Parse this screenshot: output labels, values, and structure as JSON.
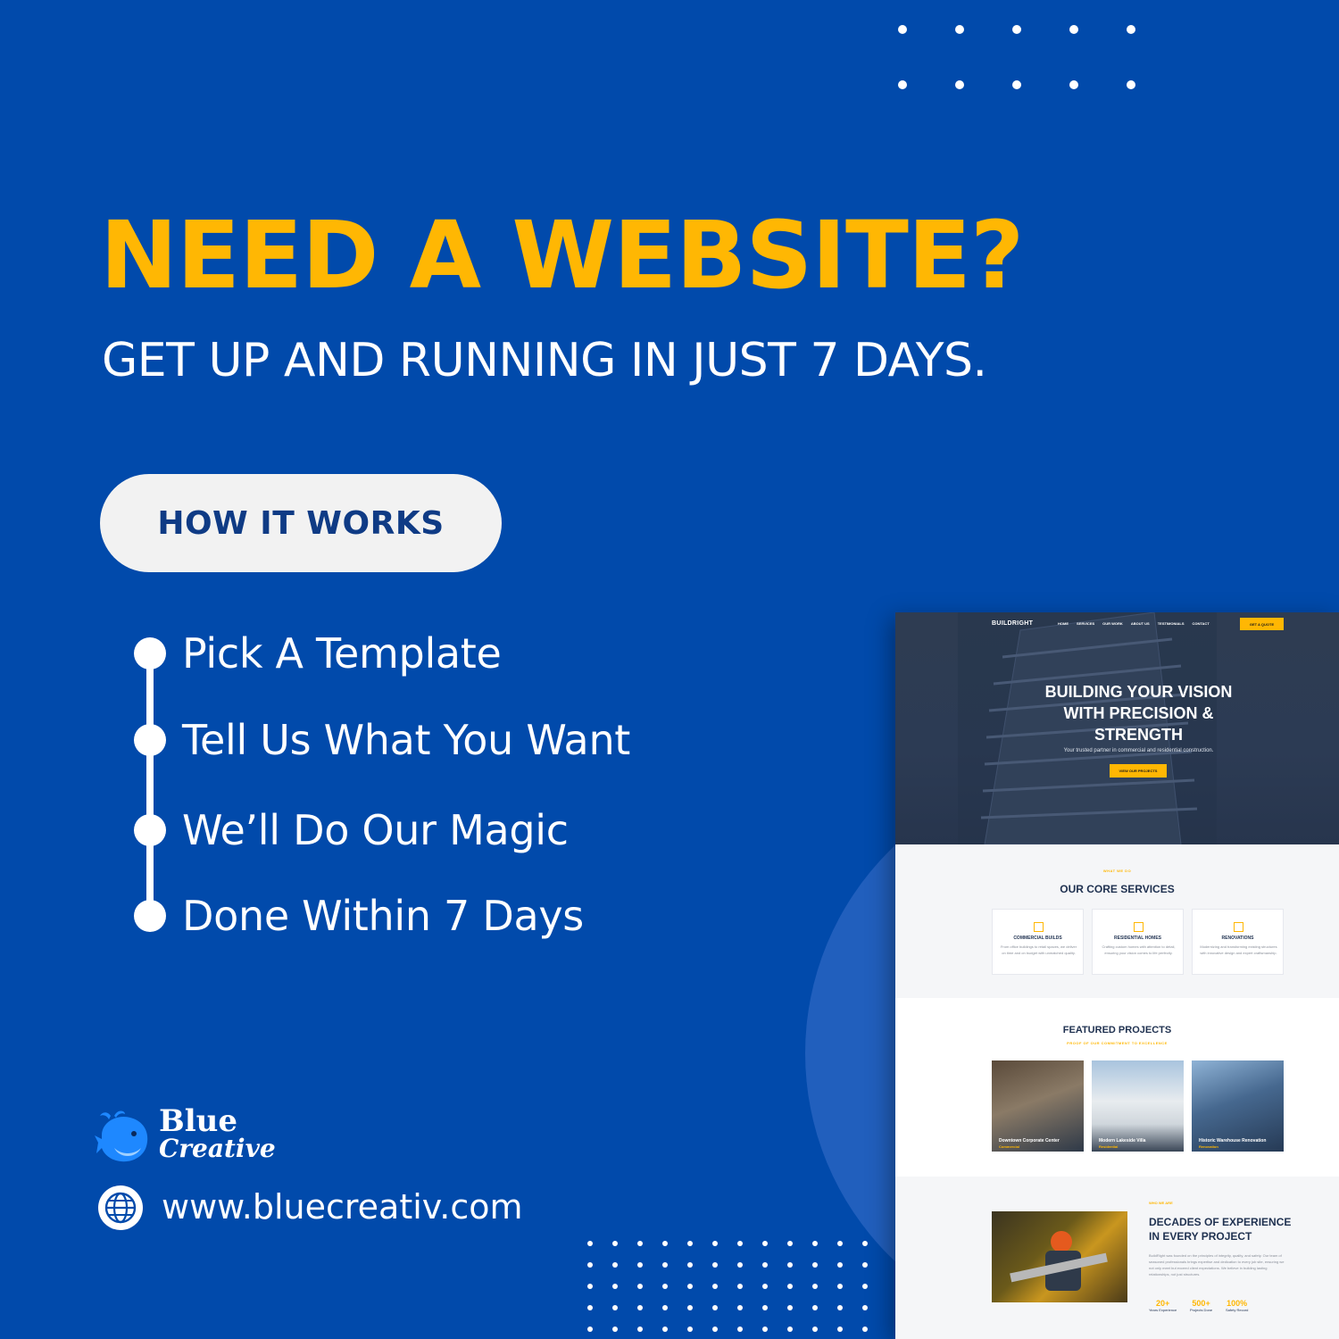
{
  "headline": "NEED A WEBSITE?",
  "subheadline": "GET UP AND RUNNING IN JUST 7 DAYS.",
  "how_it_works": {
    "label": "HOW IT WORKS",
    "steps": [
      "Pick A Template",
      "Tell Us What You Want",
      "We’ll Do Our Magic",
      "Done Within 7 Days"
    ]
  },
  "brand": {
    "name_line1": "Blue",
    "name_line2": "Creative",
    "website": "www.bluecreativ.com"
  },
  "colors": {
    "background": "#014aab",
    "accent": "#ffb703",
    "pill": "#f2f2f2",
    "pill_text": "#0f3b85"
  },
  "mockup": {
    "brand": "BUILDRIGHT",
    "nav": [
      "HOME",
      "SERVICES",
      "OUR WORK",
      "ABOUT US",
      "TESTIMONIALS",
      "CONTACT"
    ],
    "nav_button": "GET A QUOTE",
    "hero_title": "BUILDING YOUR VISION WITH PRECISION & STRENGTH",
    "hero_subtitle": "Your trusted partner in commercial and residential construction.",
    "hero_button": "VIEW OUR PROJECTS",
    "services": {
      "eyebrow": "WHAT WE DO",
      "title": "OUR CORE SERVICES",
      "cards": [
        {
          "title": "COMMERCIAL BUILDS",
          "text": "From office buildings to retail spaces, we deliver on time and on budget with unmatched quality."
        },
        {
          "title": "RESIDENTIAL HOMES",
          "text": "Crafting custom homes with attention to detail, ensuring your vision comes to life perfectly."
        },
        {
          "title": "RENOVATIONS",
          "text": "Modernizing and transforming existing structures with innovative design and expert craftsmanship."
        }
      ]
    },
    "projects": {
      "title": "FEATURED PROJECTS",
      "subtitle": "PROOF OF OUR COMMITMENT TO EXCELLENCE",
      "items": [
        {
          "name": "Downtown Corporate Center",
          "tag": "Commercial"
        },
        {
          "name": "Modern Lakeside Villa",
          "tag": "Residential"
        },
        {
          "name": "Historic Warehouse Renovation",
          "tag": "Renovation"
        }
      ]
    },
    "about": {
      "eyebrow": "WHO WE ARE",
      "title": "DECADES OF EXPERIENCE IN EVERY PROJECT",
      "text": "BuildRight was founded on the principles of integrity, quality, and safety. Our team of seasoned professionals brings expertise and dedication to every job site, ensuring we not only meet but exceed client expectations. We believe in building lasting relationships, not just structures.",
      "stats": [
        {
          "value": "20+",
          "label": "Years Experience"
        },
        {
          "value": "500+",
          "label": "Projects Done"
        },
        {
          "value": "100%",
          "label": "Safety Record"
        }
      ]
    }
  }
}
